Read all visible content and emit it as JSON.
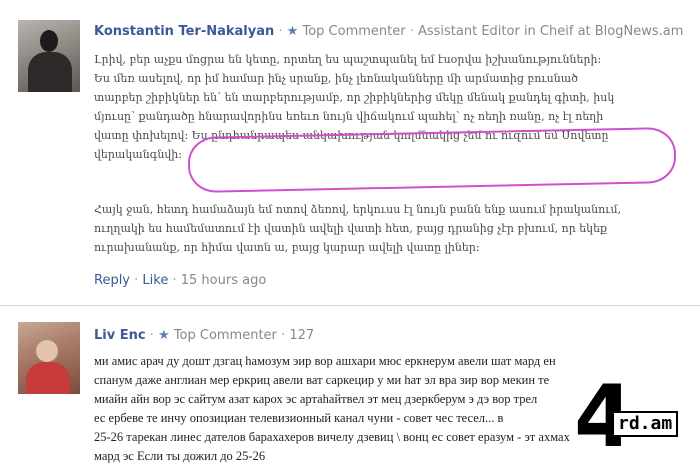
{
  "comments": [
    {
      "author": "Konstantin Ter-Nakalyan",
      "badge": "Top Commenter",
      "role": "Assistant Editor in Cheif at BlogNews.am",
      "body_lines": [
        "Լրիվ, բեր աչքս մոցրա են կետը, որտեղ ես պաշտպանել եմ էսօրվա իշխանությունների:",
        "Ես մեռ ասելով, որ իմ համար ինչ սրանք, ինչ լեոնականները մի արմատից բուսնած",
        "տարբեր շիբիկներ են՝ են տարբերությամբ, որ շիբիկներից մեկը մենակ քանդել գիտի, իսկ",
        "մյուսը՝ քանդածը հնարավորինս եռեւո նույն վիճակում պահել՝ ոչ ոեղի ռանը, ոչ էլ ոեղի",
        "վատը փոխելով։ Ես ընդհանրապես անկախության կողմնակից չեմ ու ուզում եմ Սովետը",
        "վերականգնվի։"
      ],
      "body2_lines": [
        "Հայկ ջան, հետդ համաձայն եմ ոտով ձեռով, երկուսս էլ նույն բանն ենք ասում իրականում,",
        "ուղղակի ես համեմատում էի վատին ավելի վատի հետ, բայց դրանից չէր բխում, որ եկեք",
        "ուրախանանք, որ հիմա վատն ա, բայց կարար ավելի վատը լիներ։"
      ],
      "actions": {
        "reply": "Reply",
        "like": "Like",
        "time": "15 hours ago"
      }
    },
    {
      "author": "Liv Enc",
      "badge": "Top Commenter",
      "count": "127",
      "body_lines": [
        "ми амис арач ду дошт дзгац hамозум эир вор ашхари мюс еркнерум авели шат мард ен",
        "спанум даже англиан мер еркриц авели ват саркецир у ми hат эл вра зир вор мекин те",
        "миайн айн вор эс сайтум азат карох эс артаhайтвел эт мец дзеркберум э дэ вор трел",
        "ес ербеве те инчу опозициан телевизионный канал чуни - совет чес тесел... в",
        "25-26 тарекан линес дателов барахахеров вичелу дзевиц \\ вонц ес совет еразум - эт ахмах",
        "мард эс Если ты дожил до 25-26"
      ]
    }
  ],
  "logo_text": {
    "digit": "4",
    "domain": "rd.am"
  }
}
